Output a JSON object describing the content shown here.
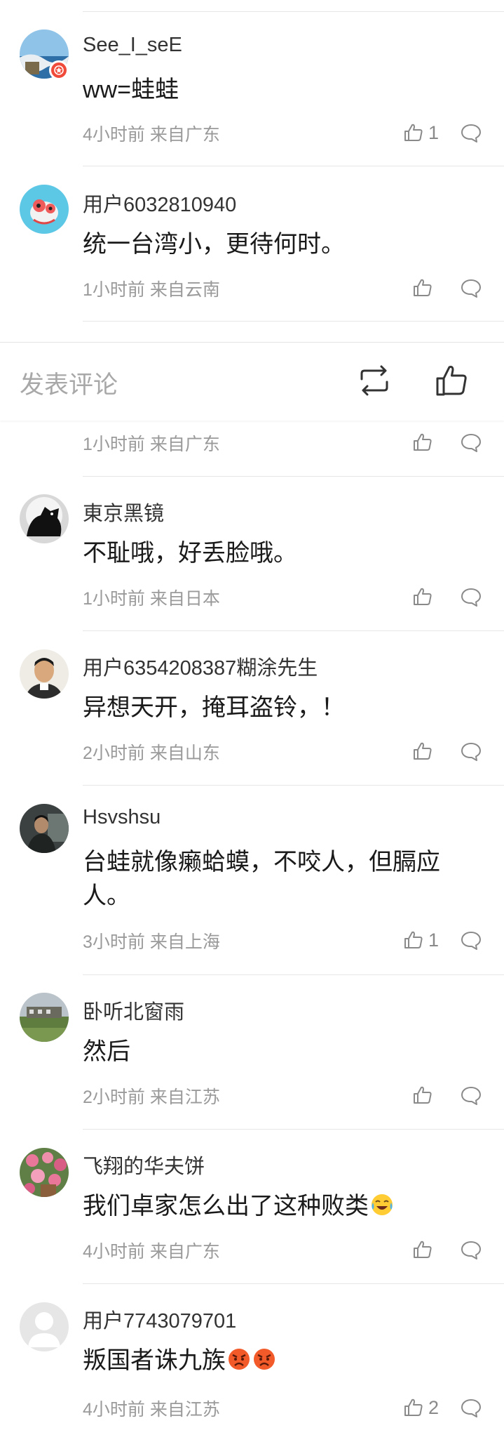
{
  "compose_bar": {
    "label": "发表评论",
    "repost_icon": "repost-icon",
    "like_icon": "thumbs-up-icon"
  },
  "comments": [
    {
      "user": "See_I_seE",
      "text": "ww=蛙蛙",
      "time": "4小时前",
      "source": "来自广东",
      "likes": "1",
      "badge": true,
      "avatar": "sea-waves"
    },
    {
      "user": "用户6032810940",
      "text": "统一台湾小，更待何时。",
      "time": "1小时前",
      "source": "来自云南",
      "likes": "",
      "avatar": "cartoon-fish"
    },
    {
      "user": "",
      "text": "",
      "time": "1小时前",
      "source": "来自广东",
      "likes": ""
    },
    {
      "user": "東京黑镜",
      "text": "不耻哦，好丢脸哦。",
      "time": "1小时前",
      "source": "来自日本",
      "likes": "",
      "avatar": "black-bear"
    },
    {
      "user": "用户6354208387糊涂先生",
      "text": "异想天开，掩耳盗铃，！",
      "time": "2小时前",
      "source": "来自山东",
      "likes": "",
      "avatar": "man-portrait"
    },
    {
      "user": "Hsvshsu",
      "text": "台蛙就像癞蛤蟆，不咬人，但膈应人。",
      "time": "3小时前",
      "source": "来自上海",
      "likes": "1",
      "avatar": "dark-photo"
    },
    {
      "user": "卧听北窗雨",
      "text": "然后",
      "time": "2小时前",
      "source": "来自江苏",
      "likes": "",
      "avatar": "landscape"
    },
    {
      "user": "飞翔的华夫饼",
      "text": "我们卓家怎么出了这种败类",
      "emoji": [
        "laughing-crying-emoji"
      ],
      "time": "4小时前",
      "source": "来自广东",
      "likes": "",
      "avatar": "roses"
    },
    {
      "user": "用户7743079701",
      "text": "叛国者诛九族",
      "emoji": [
        "angry-face-emoji",
        "angry-face-emoji"
      ],
      "time": "4小时前",
      "source": "来自江苏",
      "likes": "2",
      "avatar": "default-user"
    }
  ],
  "colors": {
    "meta": "#9a9a9a",
    "divider": "#e6e6e6",
    "badge": "#f04a3a"
  }
}
